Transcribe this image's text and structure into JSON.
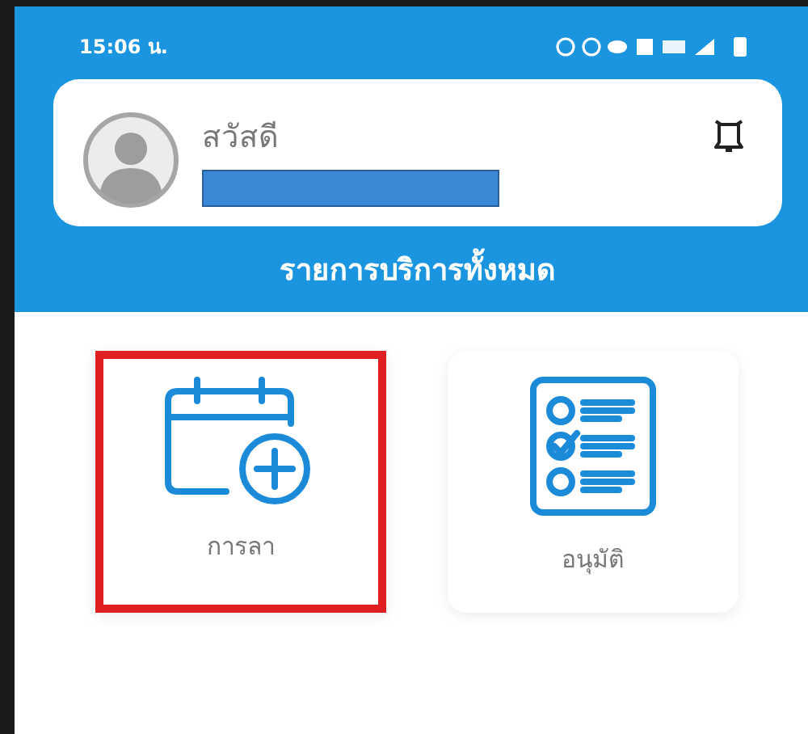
{
  "status_bar": {
    "time": "15:06 น."
  },
  "profile": {
    "greeting": "สวัสดี",
    "name_redacted": true
  },
  "section_title": "รายการบริการทั้งหมด",
  "services": [
    {
      "kind": "calendar-add",
      "label": "การลา",
      "highlighted": true
    },
    {
      "kind": "checklist",
      "label": "อนุมัติ",
      "highlighted": false
    }
  ]
}
